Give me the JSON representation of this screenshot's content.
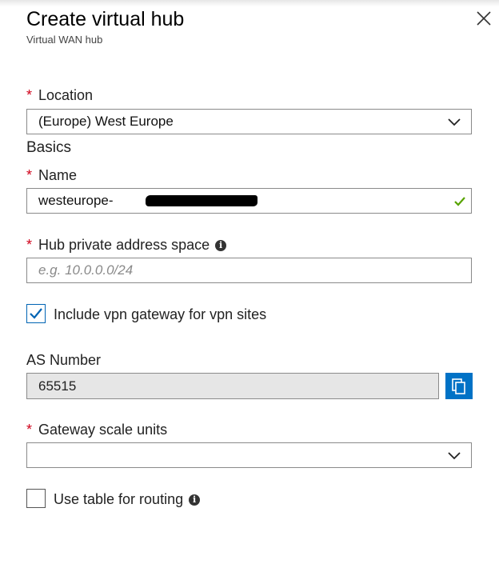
{
  "header": {
    "title": "Create virtual hub",
    "subtitle": "Virtual WAN hub"
  },
  "location": {
    "label": "Location",
    "value": "(Europe) West Europe"
  },
  "basics": {
    "section_title": "Basics"
  },
  "name": {
    "label": "Name",
    "value": "westeurope-"
  },
  "address_space": {
    "label": "Hub private address space",
    "placeholder": "e.g. 10.0.0.0/24"
  },
  "vpn_gateway": {
    "label": "Include vpn gateway for vpn sites",
    "checked": true
  },
  "as_number": {
    "label": "AS Number",
    "value": "65515"
  },
  "gateway_scale": {
    "label": "Gateway scale units",
    "value": ""
  },
  "routing_table": {
    "label": "Use table for routing",
    "checked": false
  },
  "colors": {
    "required": "#d0021b",
    "accent": "#0072c6",
    "valid": "#57a300"
  },
  "icons": {
    "close": "close-icon",
    "info": "info-icon",
    "copy": "copy-icon",
    "dropdown": "chevron-down-icon",
    "valid": "checkmark-icon"
  }
}
